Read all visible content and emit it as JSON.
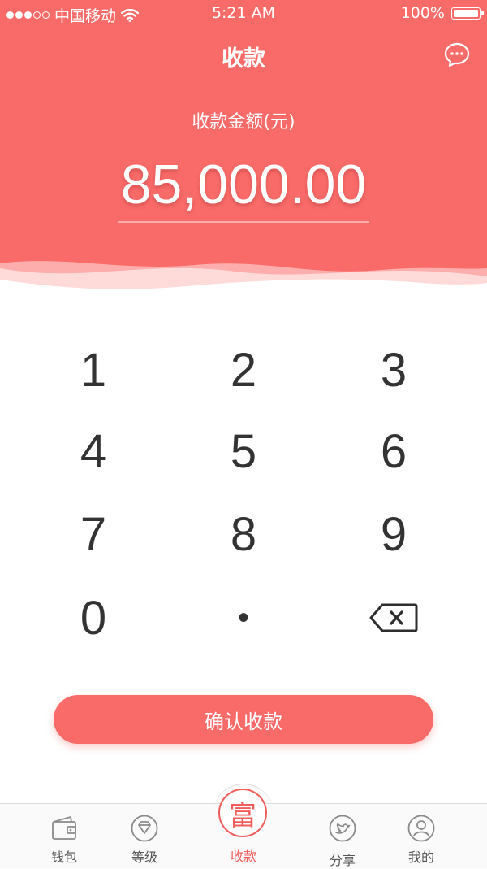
{
  "status_bar": {
    "carrier": "中国移动",
    "time": "5:21 AM",
    "battery": "100%"
  },
  "nav": {
    "title": "收款",
    "chat_icon": "chat-bubble-icon"
  },
  "amount": {
    "label": "收款金额(元)",
    "value": "85,000.00"
  },
  "keypad": {
    "keys": [
      "1",
      "2",
      "3",
      "4",
      "5",
      "6",
      "7",
      "8",
      "9",
      "0",
      "•"
    ],
    "delete_icon": "backspace-icon"
  },
  "confirm_button": "确认收款",
  "tabs": [
    {
      "label": "钱包",
      "icon": "wallet-icon"
    },
    {
      "label": "等级",
      "icon": "diamond-icon"
    },
    {
      "label": "收款",
      "icon": "fu-character-icon",
      "glyph": "富",
      "active": true
    },
    {
      "label": "分享",
      "icon": "twitter-bird-icon"
    },
    {
      "label": "我的",
      "icon": "user-icon"
    }
  ],
  "colors": {
    "primary": "#f96b69",
    "active_tab": "#f25c5a",
    "text": "#333333"
  }
}
